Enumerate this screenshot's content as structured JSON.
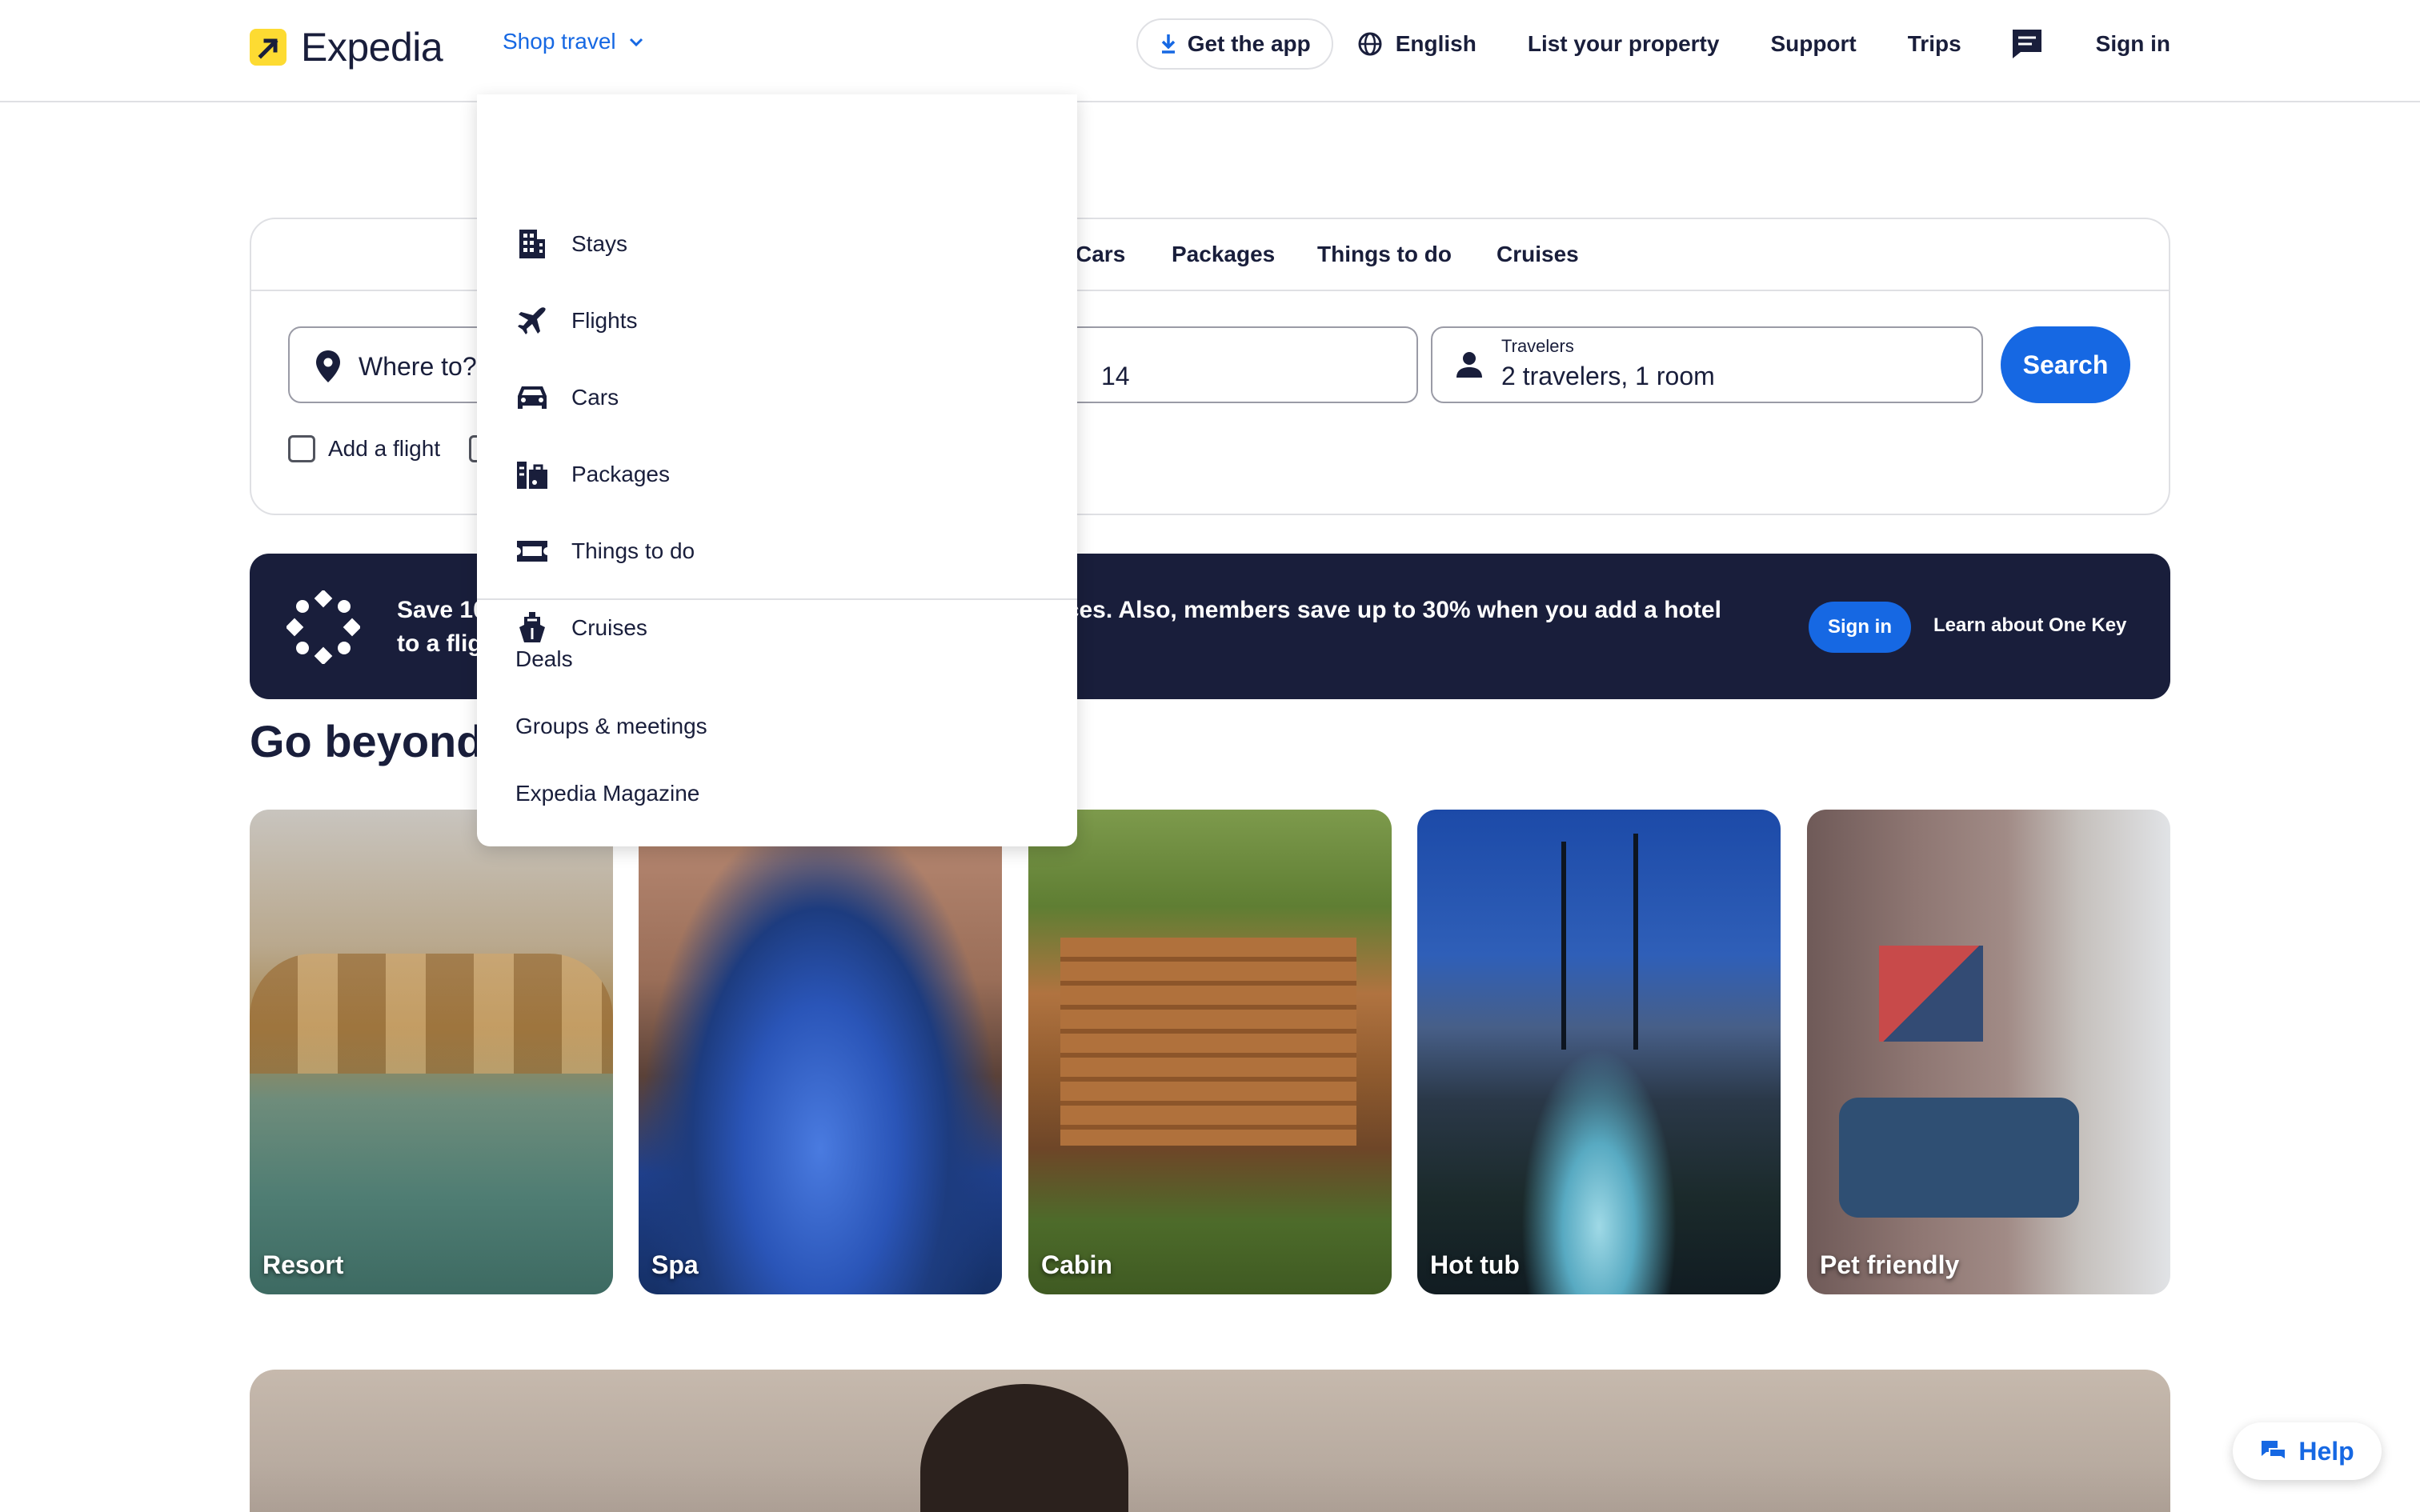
{
  "header": {
    "logo_text": "Expedia",
    "shop_travel": "Shop travel",
    "get_app": "Get the app",
    "language": "English",
    "list_property": "List your property",
    "support": "Support",
    "trips": "Trips",
    "sign_in": "Sign in"
  },
  "dropdown": {
    "items": [
      {
        "label": "Stays",
        "icon": "building-icon"
      },
      {
        "label": "Flights",
        "icon": "airplane-icon"
      },
      {
        "label": "Cars",
        "icon": "car-icon"
      },
      {
        "label": "Packages",
        "icon": "packages-icon"
      },
      {
        "label": "Things to do",
        "icon": "ticket-icon"
      },
      {
        "label": "Cruises",
        "icon": "ship-icon"
      }
    ],
    "links": [
      "Deals",
      "Groups & meetings",
      "Expedia Magazine"
    ]
  },
  "search": {
    "tabs": [
      "Cars",
      "Packages",
      "Things to do",
      "Cruises"
    ],
    "where_placeholder": "Where to?",
    "dates_partial": "14",
    "travelers_label": "Travelers",
    "travelers_value": "2 travelers, 1 room",
    "search_button": "Search",
    "add_flight": "Add a flight"
  },
  "banner": {
    "text_line1_start": "Save 10",
    "text_line1_end": "rices. Also, members save up to 30% when you add a hotel",
    "text_line2": "to a flig",
    "sign_in": "Sign in",
    "learn": "Learn about One Key"
  },
  "section": {
    "title": "Go beyond",
    "cards": [
      "Resort",
      "Spa",
      "Cabin",
      "Hot tub",
      "Pet friendly"
    ]
  },
  "help": "Help",
  "colors": {
    "brand_blue": "#1668e3",
    "navy": "#191e3b",
    "logo_yellow": "#fddb32",
    "border": "#dfe0e4"
  }
}
